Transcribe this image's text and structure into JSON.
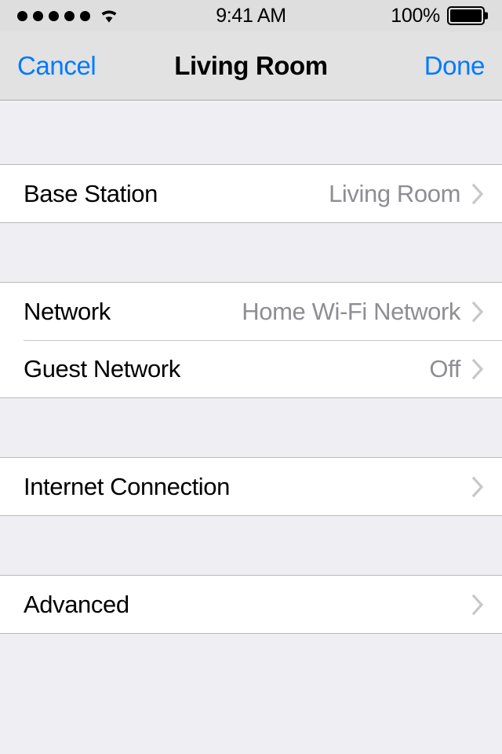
{
  "status_bar": {
    "signal_dots": 5,
    "signal_icon": "signal-dots-icon",
    "wifi_icon": "wifi-icon",
    "time": "9:41 AM",
    "battery_percent": "100%",
    "battery_icon": "battery-full-icon"
  },
  "nav_bar": {
    "cancel_label": "Cancel",
    "title": "Living Room",
    "done_label": "Done"
  },
  "colors": {
    "accent": "#007AFF",
    "value_text": "#8E8E93",
    "table_background": "#EFEEF3",
    "row_background": "#FFFFFF",
    "separator": "#C8C7CC",
    "navbar_background": "#E2E2E2",
    "statusbar_background": "#DEDEDE"
  },
  "groups": [
    {
      "rows": [
        {
          "label": "Base Station",
          "value": "Living Room",
          "chevron": true
        }
      ]
    },
    {
      "rows": [
        {
          "label": "Network",
          "value": "Home Wi-Fi Network",
          "chevron": true
        },
        {
          "label": "Guest Network",
          "value": "Off",
          "chevron": true
        }
      ]
    },
    {
      "rows": [
        {
          "label": "Internet Connection",
          "value": "",
          "chevron": true
        }
      ]
    },
    {
      "rows": [
        {
          "label": "Advanced",
          "value": "",
          "chevron": true
        }
      ]
    }
  ]
}
